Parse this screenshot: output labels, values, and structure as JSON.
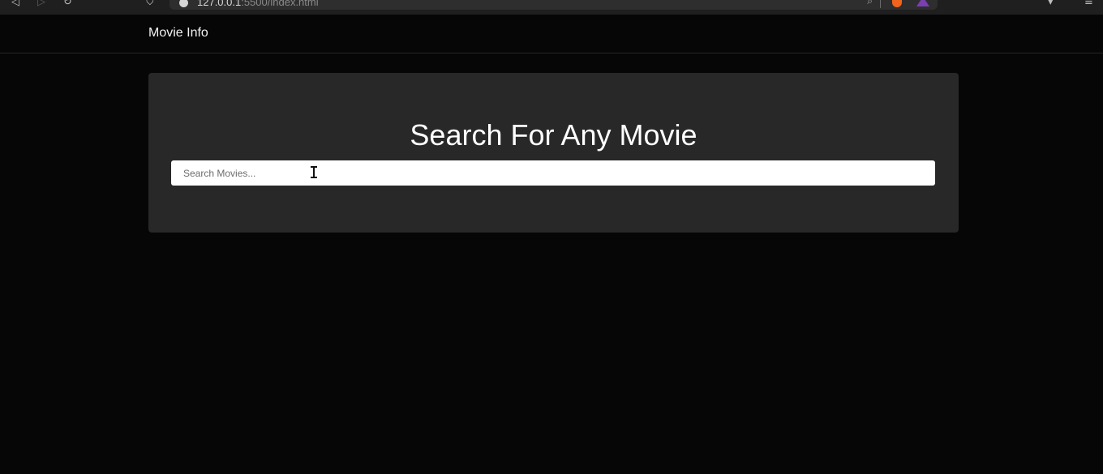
{
  "browser": {
    "url_host": "127.0.0.1",
    "url_rest": ":5500/index.html"
  },
  "navbar": {
    "brand": "Movie Info"
  },
  "hero": {
    "title": "Search For Any Movie",
    "search": {
      "placeholder": "Search Movies...",
      "value": ""
    }
  },
  "colors": {
    "page_background": "#060606",
    "panel_background": "#282828",
    "text": "#ffffff"
  }
}
